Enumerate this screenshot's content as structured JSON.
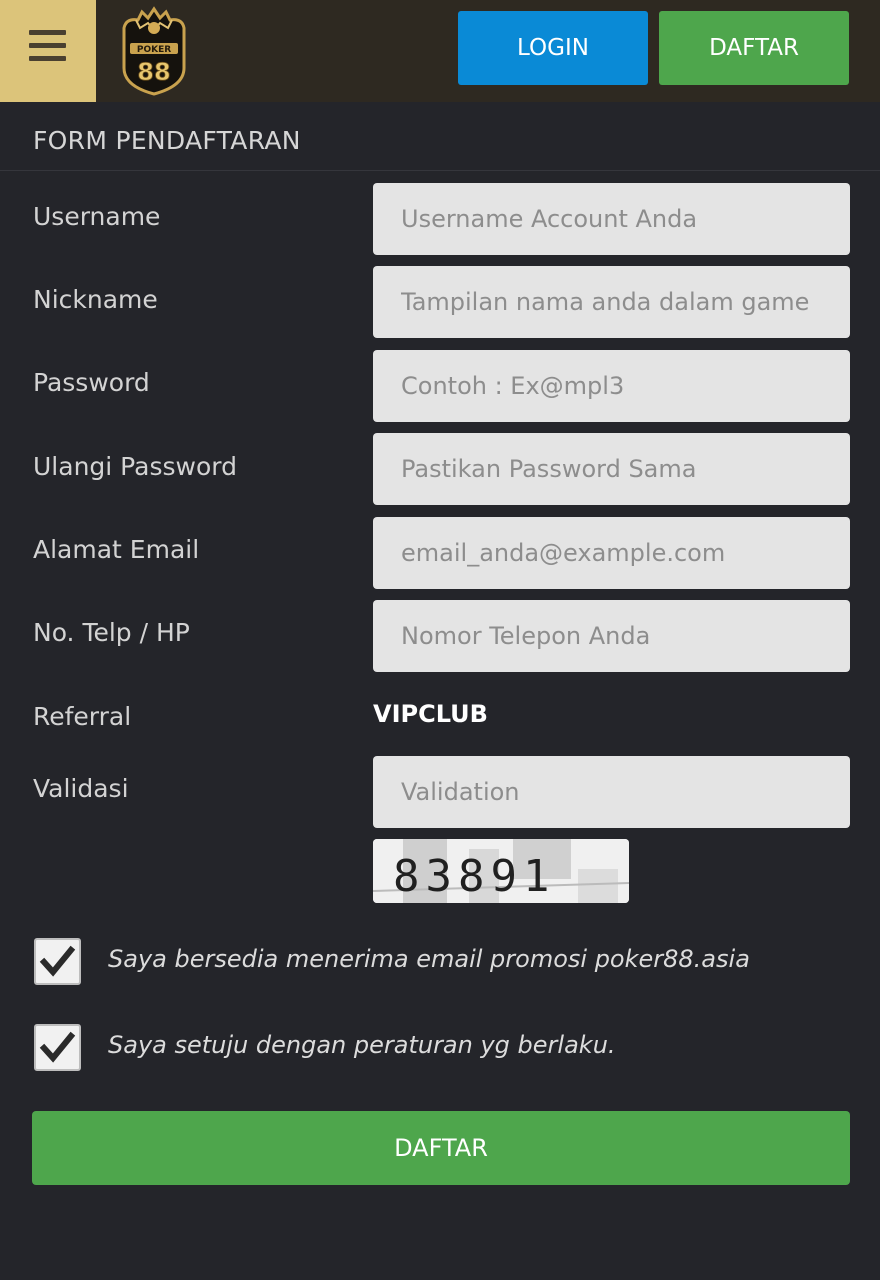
{
  "header": {
    "login_label": "LOGIN",
    "register_label": "DAFTAR",
    "logo_text": "POKER 88"
  },
  "form": {
    "title": "FORM PENDAFTARAN",
    "fields": [
      {
        "label": "Username",
        "placeholder": "Username Account Anda"
      },
      {
        "label": "Nickname",
        "placeholder": "Tampilan nama anda dalam game"
      },
      {
        "label": "Password",
        "placeholder": "Contoh : Ex@mpl3"
      },
      {
        "label": "Ulangi Password",
        "placeholder": "Pastikan Password Sama"
      },
      {
        "label": "Alamat Email",
        "placeholder": "email_anda@example.com"
      },
      {
        "label": "No. Telp / HP",
        "placeholder": "Nomor Telepon Anda"
      }
    ],
    "referral": {
      "label": "Referral",
      "value": "VIPCLUB"
    },
    "validation": {
      "label": "Validasi",
      "placeholder": "Validation",
      "captcha_code": "83891"
    },
    "checkboxes": [
      {
        "label": "Saya bersedia menerima email promosi poker88.asia",
        "checked": true
      },
      {
        "label": "Saya setuju dengan peraturan yg berlaku.",
        "checked": true
      }
    ],
    "submit_label": "DAFTAR"
  },
  "colors": {
    "background": "#24252a",
    "header": "#2e2921",
    "menu": "#dcc47a",
    "login": "#0a8ad6",
    "register": "#4ea64c"
  }
}
